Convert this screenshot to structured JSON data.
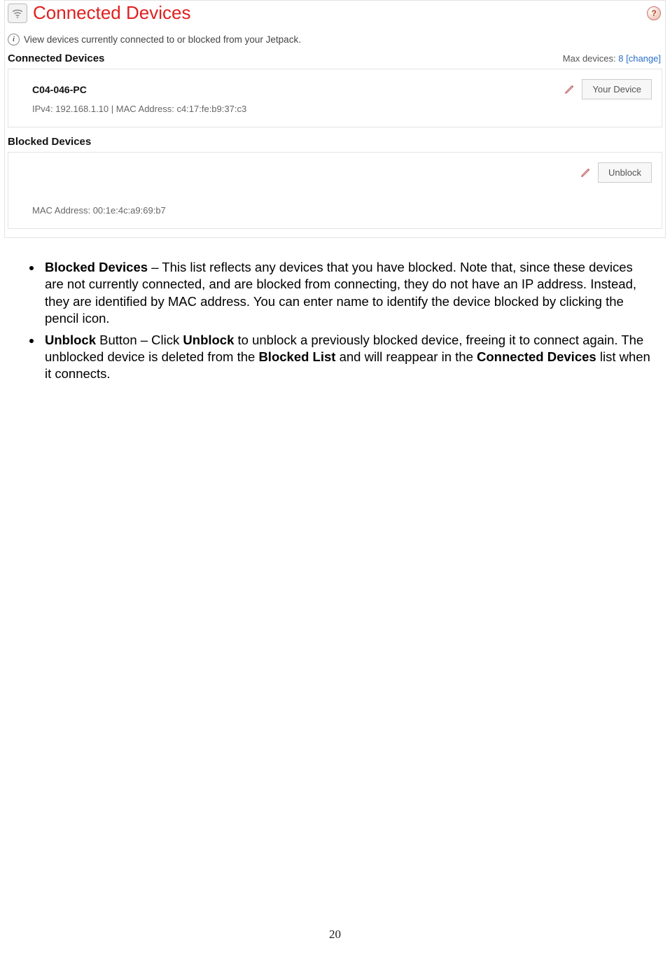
{
  "header": {
    "title": "Connected Devices",
    "help_glyph": "?"
  },
  "info": {
    "text": "View devices currently connected to or blocked from your Jetpack.",
    "glyph": "i"
  },
  "connected": {
    "section_title": "Connected Devices",
    "max_label": "Max devices: ",
    "max_value": "8",
    "change_label": " [change]",
    "device": {
      "name": "C04-046-PC",
      "details": "IPv4: 192.168.1.10 | MAC Address: c4:17:fe:b9:37:c3",
      "button_label": "Your Device"
    }
  },
  "blocked": {
    "section_title": "Blocked Devices",
    "device": {
      "details": "MAC Address: 00:1e:4c:a9:69:b7",
      "button_label": "Unblock"
    }
  },
  "doc": {
    "bullet1_strong": "Blocked Devices",
    "bullet1_rest": " – This list reflects any devices that you have blocked. Note that, since these devices are not currently connected, and are blocked from connecting, they do not have an IP address. Instead, they are identified by MAC address. You can enter name to identify the device blocked by clicking the pencil icon.",
    "bullet2_strong1": "Unblock",
    "bullet2_mid1": " Button – Click ",
    "bullet2_strong2": "Unblock",
    "bullet2_mid2": " to unblock a previously blocked device, freeing it to connect again. The unblocked device is deleted from the ",
    "bullet2_strong3": "Blocked List",
    "bullet2_mid3": " and will reappear in the ",
    "bullet2_strong4": "Connected Devices",
    "bullet2_end": " list when it connects."
  },
  "page_number": "20"
}
